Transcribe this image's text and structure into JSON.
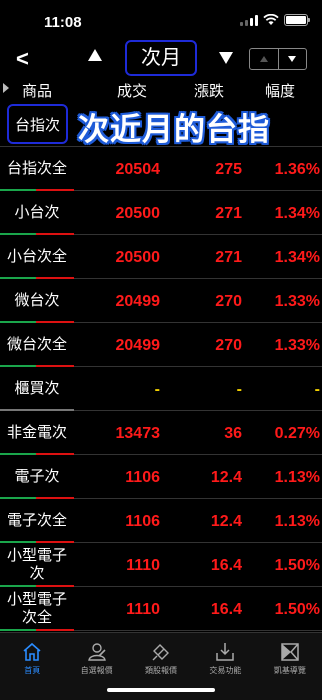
{
  "status": {
    "time": "11:08"
  },
  "nav": {
    "back_label": "<",
    "title": "次月"
  },
  "header": {
    "col_name": "商品",
    "col_price": "成交",
    "col_change": "漲跌",
    "col_pct": "幅度"
  },
  "banner": {
    "first_row_name": "台指次",
    "overlay_text": "次近月的台指",
    "first_row_peek": "2"
  },
  "rows": [
    {
      "name": "台指次全",
      "price": "20504",
      "change": "275",
      "pct": "1.36%",
      "color": "red"
    },
    {
      "name": "小台次",
      "price": "20500",
      "change": "271",
      "pct": "1.34%",
      "color": "red"
    },
    {
      "name": "小台次全",
      "price": "20500",
      "change": "271",
      "pct": "1.34%",
      "color": "red"
    },
    {
      "name": "微台次",
      "price": "20499",
      "change": "270",
      "pct": "1.33%",
      "color": "red"
    },
    {
      "name": "微台次全",
      "price": "20499",
      "change": "270",
      "pct": "1.33%",
      "color": "red"
    },
    {
      "name": "櫃買次",
      "price": "-",
      "change": "-",
      "pct": "-",
      "color": "yellow"
    },
    {
      "name": "非金電次",
      "price": "13473",
      "change": "36",
      "pct": "0.27%",
      "color": "red"
    },
    {
      "name": "電子次",
      "price": "1106",
      "change": "12.4",
      "pct": "1.13%",
      "color": "red"
    },
    {
      "name": "電子次全",
      "price": "1106",
      "change": "12.4",
      "pct": "1.13%",
      "color": "red"
    },
    {
      "name": "小型電子次",
      "price": "1110",
      "change": "16.4",
      "pct": "1.50%",
      "color": "red"
    },
    {
      "name": "小型電子次全",
      "price": "1110",
      "change": "16.4",
      "pct": "1.50%",
      "color": "red"
    }
  ],
  "tabs": [
    {
      "label": "首頁",
      "icon": "home-icon",
      "active": true
    },
    {
      "label": "自選報價",
      "icon": "watchlist-icon",
      "active": false
    },
    {
      "label": "類股報價",
      "icon": "sector-icon",
      "active": false
    },
    {
      "label": "交易功能",
      "icon": "trade-icon",
      "active": false
    },
    {
      "label": "凱基導覽",
      "icon": "guide-icon",
      "active": false
    }
  ],
  "colors": {
    "up": "#ff1a1a",
    "flat": "#f2d000",
    "accent": "#2a8cff",
    "highlight_box": "#1e2bd8"
  }
}
